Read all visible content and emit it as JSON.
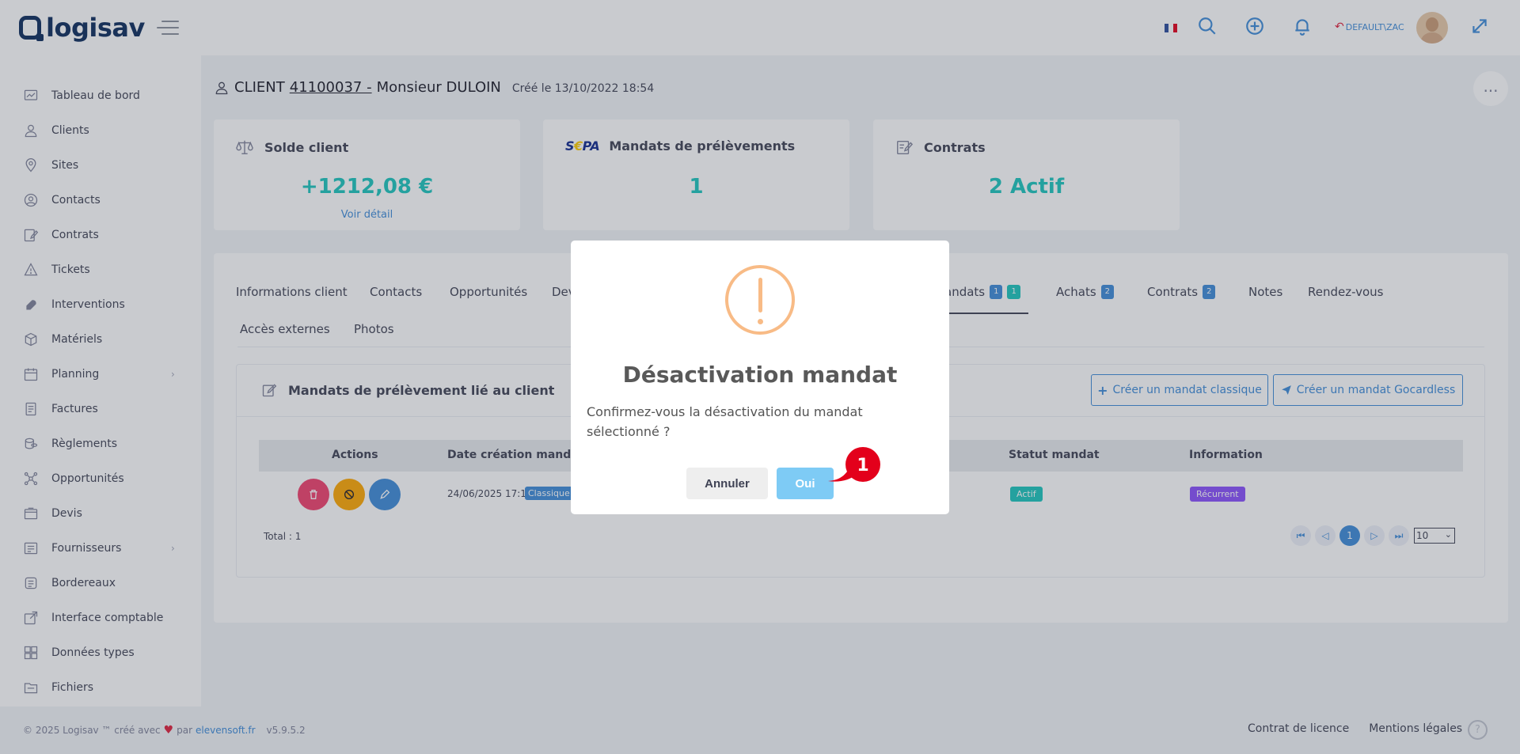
{
  "app": {
    "logo_text": "logisav"
  },
  "header": {
    "user_label": "DEFAULT\\ZAC",
    "icons": [
      "flag-fr-icon",
      "search-icon",
      "plus-circle-icon",
      "bell-icon",
      "switch-user-icon",
      "avatar",
      "expand-icon"
    ]
  },
  "sidebar": {
    "items": [
      {
        "label": "Tableau de bord",
        "icon": "dashboard-icon"
      },
      {
        "label": "Clients",
        "icon": "clients-icon"
      },
      {
        "label": "Sites",
        "icon": "location-icon"
      },
      {
        "label": "Contacts",
        "icon": "contacts-icon"
      },
      {
        "label": "Contrats",
        "icon": "contract-icon"
      },
      {
        "label": "Tickets",
        "icon": "ticket-icon"
      },
      {
        "label": "Interventions",
        "icon": "wrench-icon"
      },
      {
        "label": "Matériels",
        "icon": "box-icon"
      },
      {
        "label": "Planning",
        "icon": "calendar-icon",
        "has_children": true
      },
      {
        "label": "Factures",
        "icon": "invoice-icon"
      },
      {
        "label": "Règlements",
        "icon": "coins-icon"
      },
      {
        "label": "Opportunités",
        "icon": "network-icon"
      },
      {
        "label": "Devis",
        "icon": "quote-icon"
      },
      {
        "label": "Fournisseurs",
        "icon": "supplier-icon",
        "has_children": true
      },
      {
        "label": "Bordereaux",
        "icon": "slip-icon"
      },
      {
        "label": "Interface comptable",
        "icon": "export-icon"
      },
      {
        "label": "Données types",
        "icon": "grid-icon"
      },
      {
        "label": "Fichiers",
        "icon": "folder-icon"
      }
    ]
  },
  "client": {
    "prefix": "CLIENT",
    "number": " 41100037 - ",
    "name": "Monsieur DULOIN",
    "created": "Créé le 13/10/2022 18:54",
    "more": "..."
  },
  "stats": {
    "balance": {
      "title": "Solde client",
      "value": "+1212,08 €",
      "link": "Voir détail"
    },
    "mandates": {
      "logo_s": "S",
      "logo_e": "€",
      "logo_pa": "PA",
      "title": "Mandats de prélèvements",
      "value": "1"
    },
    "contracts": {
      "title": "Contrats",
      "value": "2 Actif"
    }
  },
  "tabs": {
    "row1": [
      {
        "label": "Informations client"
      },
      {
        "label": "Contacts"
      },
      {
        "label": "Opportunités"
      },
      {
        "label": "Dev"
      },
      {
        "label": "andats",
        "badges": [
          "1",
          "1"
        ]
      },
      {
        "label": "Achats",
        "badges": [
          "2"
        ]
      },
      {
        "label": "Contrats",
        "badges": [
          "2"
        ]
      },
      {
        "label": "Notes"
      },
      {
        "label": "Rendez-vous"
      }
    ],
    "row2": [
      {
        "label": "Accès externes"
      },
      {
        "label": "Photos"
      }
    ],
    "active": "andats"
  },
  "mandates_section": {
    "title": "Mandats de prélèvement lié au client",
    "btn_classic": "Créer un mandat classique",
    "btn_gocardless": "Créer un mandat Gocardless",
    "columns": [
      "Actions",
      "Date création mandat",
      "Statut mandat",
      "Information"
    ],
    "rows": [
      {
        "date": "24/06/2025 17:11",
        "type": "Classique",
        "status": "Actif",
        "info": "Récurrent"
      }
    ],
    "total": "Total : 1",
    "pagination": {
      "current": "1",
      "page_size": "10"
    }
  },
  "modal": {
    "title": "Désactivation mandat",
    "message": "Confirmez-vous la désactivation du mandat sélectionné ?",
    "cancel": "Annuler",
    "confirm": "Oui"
  },
  "callout": {
    "number": "1"
  },
  "footer": {
    "copyright": "© 2025 Logisav ™ créé avec",
    "heart": "♥",
    "by": "par",
    "link": "elevensoft.fr",
    "version": "v5.9.5.2",
    "license": "Contrat de licence",
    "legal": "Mentions légales",
    "help": "?"
  },
  "colors": {
    "accent": "#3d8bd9",
    "success": "#1bc5bd",
    "danger": "#f1416c",
    "warning": "#ffa800",
    "purple": "#8950fc",
    "modal_warning": "#f8bb86",
    "confirm_btn": "#7ecbf5",
    "callout_red": "#e3001b"
  }
}
